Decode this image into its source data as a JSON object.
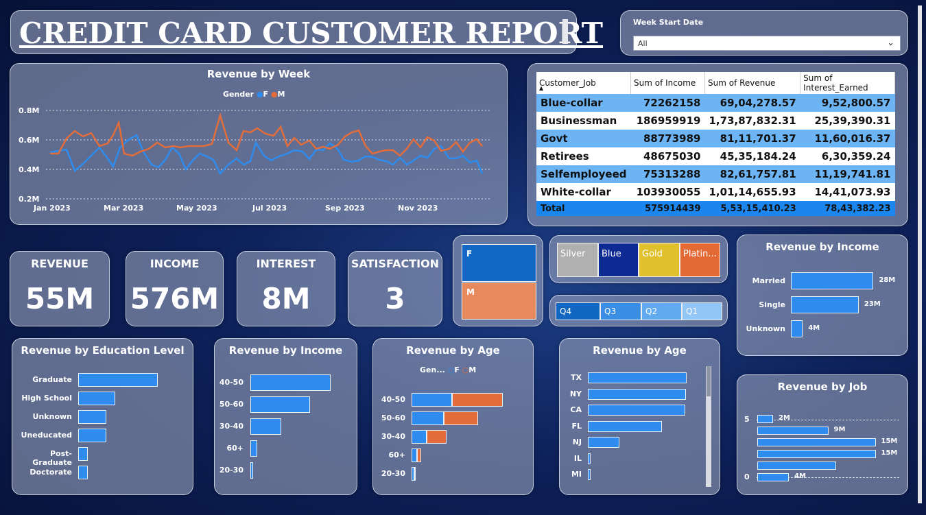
{
  "title": "CREDIT CARD  CUSTOMER REPORT",
  "slicer": {
    "label": "Week Start Date",
    "value": "All"
  },
  "revenue_by_week": {
    "title": "Revenue by Week",
    "legend_title": "Gender",
    "legend": [
      "F",
      "M"
    ],
    "y_ticks": [
      "0.8M",
      "0.6M",
      "0.4M",
      "0.2M"
    ],
    "x_ticks": [
      "Jan 2023",
      "Mar 2023",
      "May 2023",
      "Jul 2023",
      "Sep 2023",
      "Nov 2023"
    ]
  },
  "job_table": {
    "headers": [
      "Customer_Job",
      "Sum of Income",
      "Sum of Revenue",
      "Sum of Interest_Earned"
    ],
    "rows": [
      [
        "Blue-collar",
        "72262158",
        "69,04,278.57",
        "9,52,800.57"
      ],
      [
        "Businessman",
        "186959919",
        "1,73,87,832.31",
        "25,39,390.31"
      ],
      [
        "Govt",
        "88773989",
        "81,11,701.37",
        "11,60,016.37"
      ],
      [
        "Retirees",
        "48675030",
        "45,35,184.24",
        "6,30,359.24"
      ],
      [
        "Selfemployeed",
        "75313288",
        "82,61,757.81",
        "11,19,741.81"
      ],
      [
        "White-collar",
        "103930055",
        "1,01,14,655.93",
        "14,41,073.93"
      ]
    ],
    "total": [
      "Total",
      "575914439",
      "5,53,15,410.23",
      "78,43,382.23"
    ]
  },
  "kpis": [
    {
      "label": "REVENUE",
      "value": "55M"
    },
    {
      "label": "INCOME",
      "value": "576M"
    },
    {
      "label": "INTEREST",
      "value": "8M"
    },
    {
      "label": "SATISFACTION",
      "value": "3"
    }
  ],
  "gender_slicer": {
    "f": "F",
    "m": "M"
  },
  "card_slicer": {
    "silver": "Silver",
    "blue": "Blue",
    "gold": "Gold",
    "platinum": "Platin..."
  },
  "quarter_slicer": {
    "q4": "Q4",
    "q3": "Q3",
    "q2": "Q2",
    "q1": "Q1"
  },
  "income_marital": {
    "title": "Revenue by Income",
    "categories": [
      "Married",
      "Single",
      "Unknown"
    ],
    "labels": [
      "28M",
      "23M",
      "4M"
    ],
    "values": [
      28,
      23,
      4
    ]
  },
  "education": {
    "title": "Revenue by Education Level",
    "categories": [
      "Graduate",
      "High School",
      "Unknown",
      "Uneducated",
      "Post-Graduate",
      "Doctorate"
    ],
    "values": [
      17,
      8,
      6,
      6,
      2,
      2
    ]
  },
  "income_group": {
    "title": "Revenue by Income",
    "categories": [
      "40-50",
      "50-60",
      "30-40",
      "60+",
      "20-30"
    ],
    "values": [
      22,
      16.5,
      8.5,
      1.8,
      0.8
    ]
  },
  "age_gender": {
    "title": "Revenue by Age",
    "legend_title": "Gen...",
    "legend": [
      "F",
      "M"
    ],
    "categories": [
      "40-50",
      "50-60",
      "30-40",
      "60+",
      "20-30"
    ],
    "f": [
      7.5,
      6,
      2.8,
      1,
      0.5
    ],
    "m": [
      9.5,
      6.5,
      3.8,
      0.8,
      0.3
    ]
  },
  "age_state": {
    "title": "Revenue by Age",
    "categories": [
      "TX",
      "NY",
      "CA",
      "FL",
      "NJ",
      "IL",
      "MI"
    ],
    "values": [
      14.4,
      14.3,
      14.2,
      10.8,
      4.6,
      0.4,
      0.4
    ]
  },
  "job_chart": {
    "title": "Revenue by Job",
    "y_ticks": [
      "5",
      "0"
    ],
    "labels": [
      "2M",
      "9M",
      "15M",
      "15M",
      "",
      "4M"
    ],
    "values": [
      2,
      9,
      15,
      15,
      10,
      4
    ]
  },
  "colors": {
    "female": "#2e8cee",
    "male": "#e36d3a",
    "kpi_bg": "#9aa3ba"
  }
}
